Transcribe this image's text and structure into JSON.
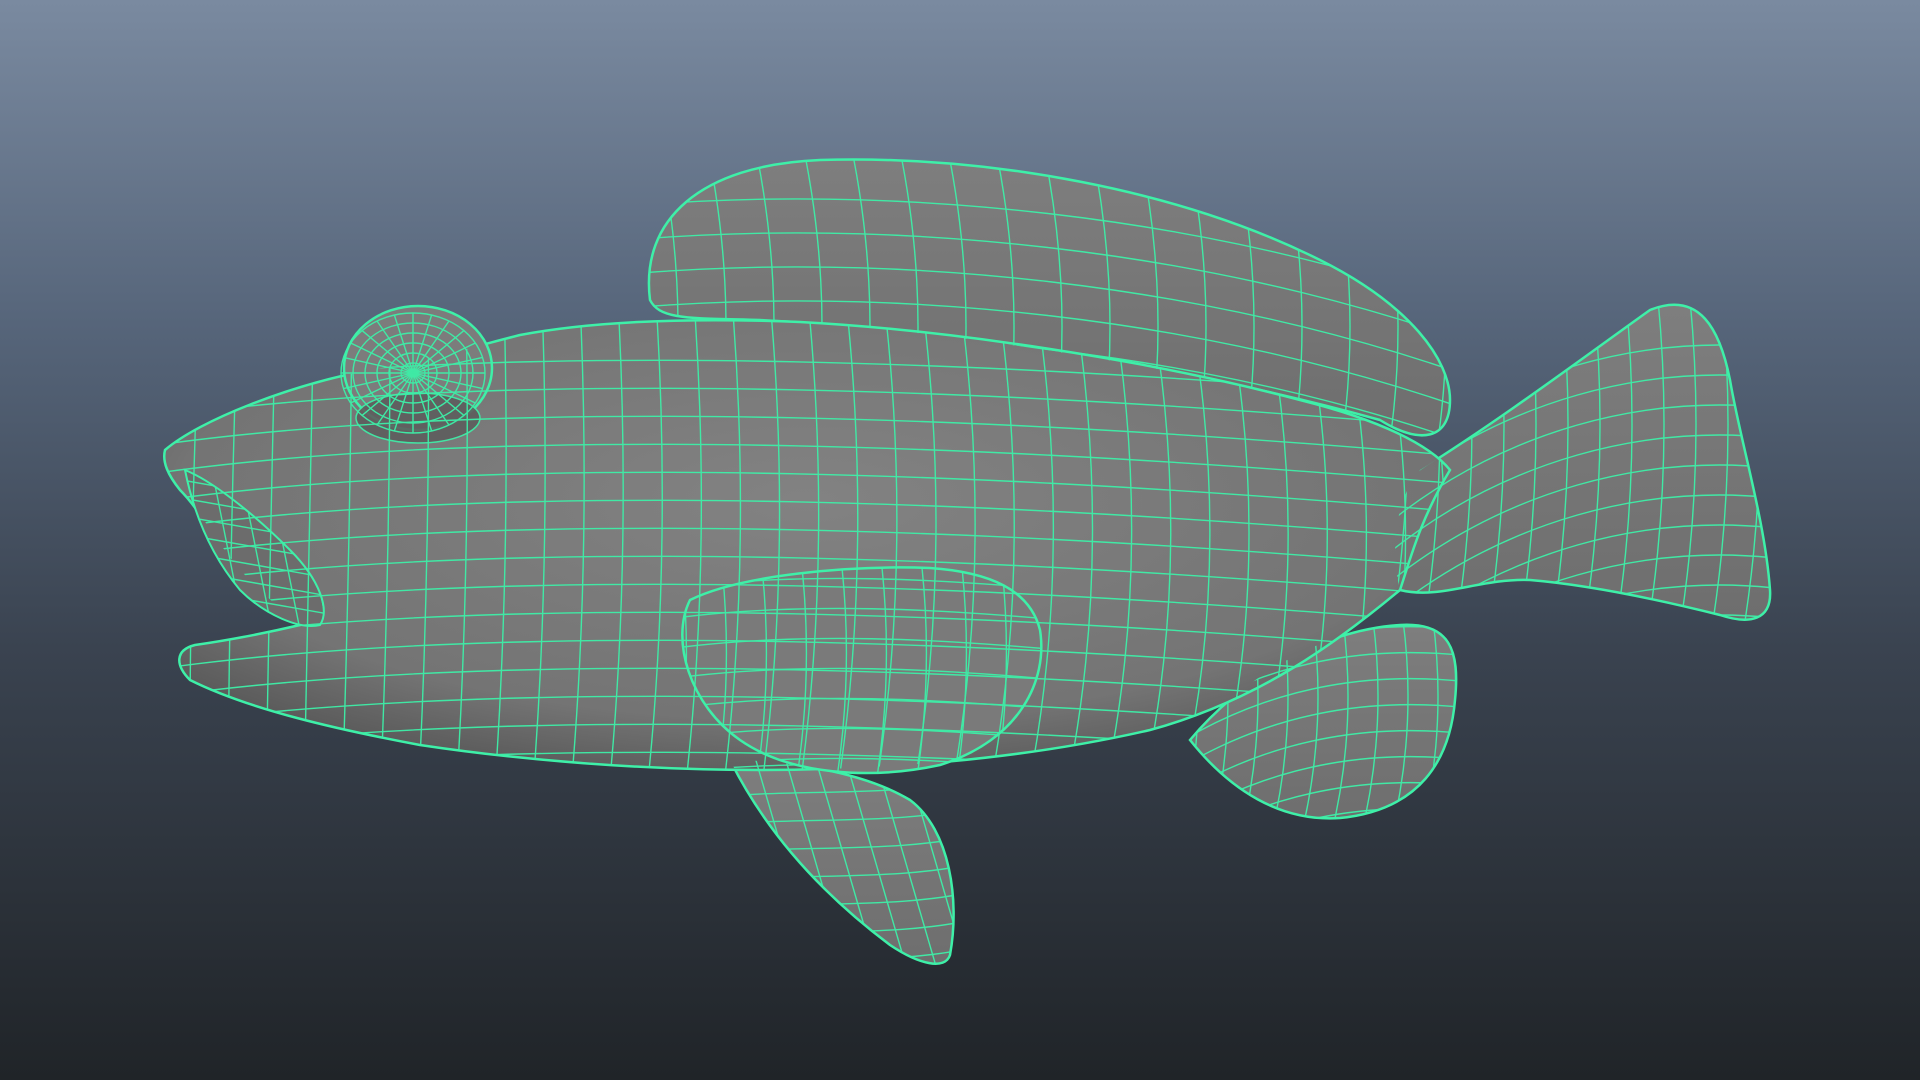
{
  "viewport": {
    "background_top": "#7a8aa0",
    "background_bottom": "#202428",
    "wireframe_color": "#3ef0a8",
    "surface_color": "#7a7a7a",
    "shadow_color": "#4a4a4a",
    "object": "fish-model"
  }
}
